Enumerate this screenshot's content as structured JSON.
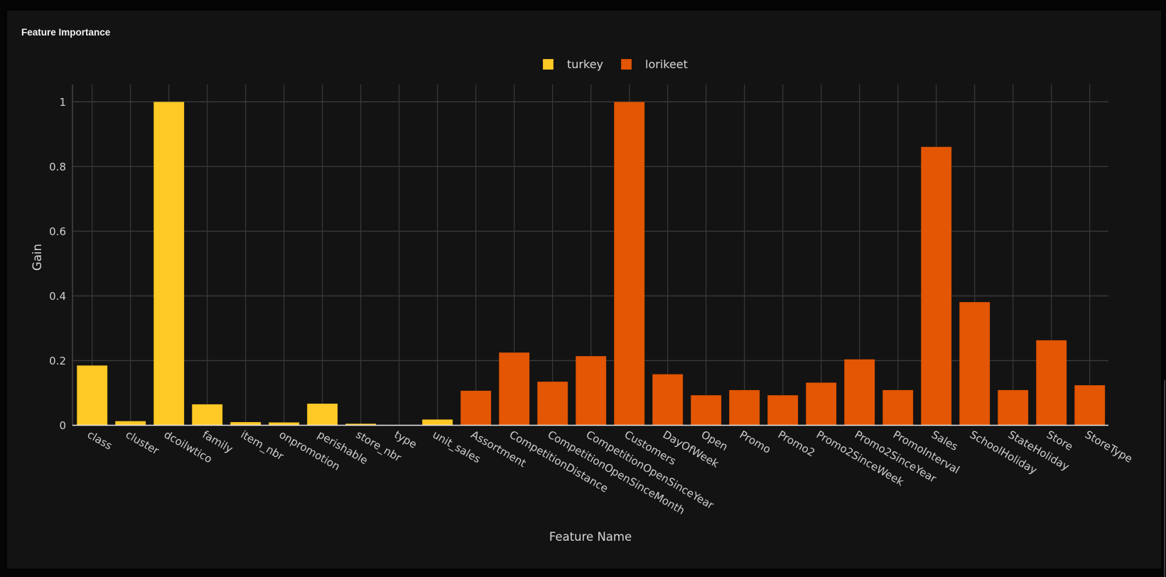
{
  "panel": {
    "title": "Feature Importance"
  },
  "chart_data": {
    "type": "bar",
    "title": "Feature Importance",
    "xlabel": "Feature Name",
    "ylabel": "Gain",
    "ylim": [
      0,
      1.05
    ],
    "yticks": [
      0,
      0.2,
      0.4,
      0.6,
      0.8,
      1
    ],
    "ytick_labels": [
      "0",
      "0.2",
      "0.4",
      "0.6",
      "0.8",
      "1"
    ],
    "grid": true,
    "legend_position": "top-center",
    "categories": [
      "class",
      "cluster",
      "dcoilwtico",
      "family",
      "item_nbr",
      "onpromotion",
      "perishable",
      "store_nbr",
      "type",
      "unit_sales",
      "Assortment",
      "CompetitionDistance",
      "CompetitionOpenSinceMonth",
      "CompetitionOpenSinceYear",
      "Customers",
      "DayOfWeek",
      "Open",
      "Promo",
      "Promo2",
      "Promo2SinceWeek",
      "Promo2SinceYear",
      "PromoInterval",
      "Sales",
      "SchoolHoliday",
      "StateHoliday",
      "Store",
      "StoreType"
    ],
    "series": [
      {
        "name": "turkey",
        "color": "#FFC926",
        "categories": [
          "class",
          "cluster",
          "dcoilwtico",
          "family",
          "item_nbr",
          "onpromotion",
          "perishable",
          "store_nbr",
          "type",
          "unit_sales"
        ],
        "values": [
          0.185,
          0.013,
          1.0,
          0.065,
          0.01,
          0.009,
          0.067,
          0.005,
          0.001,
          0.018
        ]
      },
      {
        "name": "lorikeet",
        "color": "#E35604",
        "categories": [
          "Assortment",
          "CompetitionDistance",
          "CompetitionOpenSinceMonth",
          "CompetitionOpenSinceYear",
          "Customers",
          "DayOfWeek",
          "Open",
          "Promo",
          "Promo2",
          "Promo2SinceWeek",
          "Promo2SinceYear",
          "PromoInterval",
          "Sales",
          "SchoolHoliday",
          "StateHoliday",
          "Store",
          "StoreType"
        ],
        "values": [
          0.107,
          0.225,
          0.135,
          0.214,
          1.0,
          0.158,
          0.093,
          0.109,
          0.093,
          0.132,
          0.204,
          0.109,
          0.861,
          0.381,
          0.109,
          0.263,
          0.124
        ]
      }
    ]
  }
}
